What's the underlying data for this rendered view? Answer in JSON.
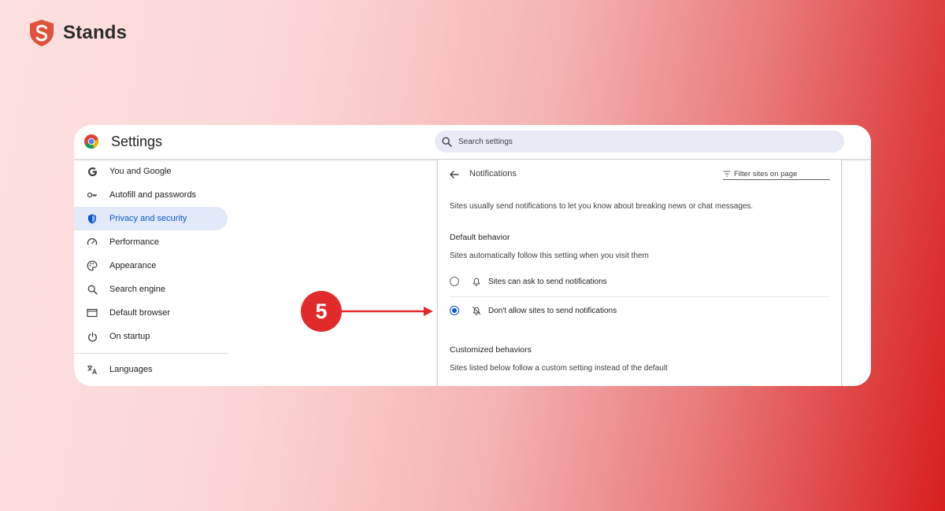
{
  "brand": {
    "name": "Stands",
    "logo_icon": "shield-s-logo-icon",
    "color": "#e0533a"
  },
  "window": {
    "title": "Settings",
    "app_icon": "chrome-logo-icon"
  },
  "search": {
    "placeholder": "Search settings",
    "icon": "search-icon"
  },
  "sidebar": {
    "items": [
      {
        "label": "You and Google",
        "icon": "google-g-icon",
        "active": false
      },
      {
        "label": "Autofill and passwords",
        "icon": "key-icon",
        "active": false
      },
      {
        "label": "Privacy and security",
        "icon": "shield-icon",
        "active": true
      },
      {
        "label": "Performance",
        "icon": "speedometer-icon",
        "active": false
      },
      {
        "label": "Appearance",
        "icon": "palette-icon",
        "active": false
      },
      {
        "label": "Search engine",
        "icon": "search-icon",
        "active": false
      },
      {
        "label": "Default browser",
        "icon": "browser-window-icon",
        "active": false
      },
      {
        "label": "On startup",
        "icon": "power-icon",
        "active": false
      },
      {
        "label": "Languages",
        "icon": "translate-icon",
        "active": false
      }
    ]
  },
  "panel": {
    "title": "Notifications",
    "back_icon": "arrow-back-icon",
    "filter_label": "Filter sites on page",
    "filter_icon": "filter-icon",
    "intro": "Sites usually send notifications to let you know about breaking news or chat messages.",
    "default_heading": "Default behavior",
    "default_desc": "Sites automatically follow this setting when you visit them",
    "options": [
      {
        "label": "Sites can ask to send notifications",
        "icon": "bell-icon",
        "checked": false
      },
      {
        "label": "Don't allow sites to send notifications",
        "icon": "bell-off-icon",
        "checked": true
      }
    ],
    "custom_heading": "Customized behaviors",
    "custom_desc": "Sites listed below follow a custom setting instead of the default"
  },
  "annotation": {
    "step_number": "5",
    "color": "#e12b2b"
  },
  "colors": {
    "accent": "#0b57d0",
    "active_nav_bg": "#e2e9f8",
    "search_bg": "#e8ebf5"
  }
}
